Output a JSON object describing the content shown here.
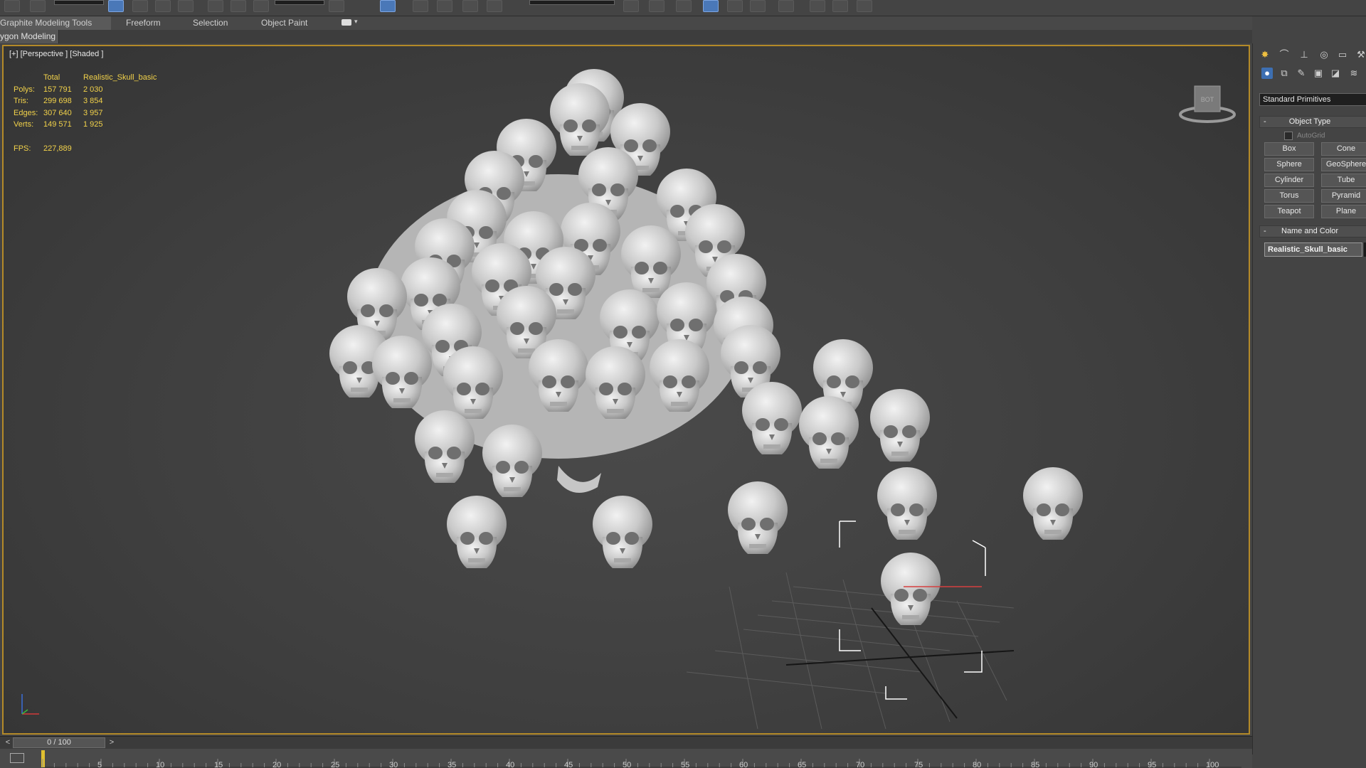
{
  "ribbon": {
    "tabs": [
      "Graphite Modeling Tools",
      "Freeform",
      "Selection",
      "Object Paint"
    ],
    "panel_label": "ygon Modeling"
  },
  "viewport": {
    "label": "[+] [Perspective ] [Shaded ]",
    "stats": {
      "header": [
        "Total",
        "Realistic_Skull_basic"
      ],
      "rows": [
        {
          "label": "Polys:",
          "total": "157 791",
          "selected": "2 030"
        },
        {
          "label": "Tris:",
          "total": "299 698",
          "selected": "3 854"
        },
        {
          "label": "Edges:",
          "total": "307 640",
          "selected": "3 957"
        },
        {
          "label": "Verts:",
          "total": "149 571",
          "selected": "1 925"
        }
      ],
      "fps_label": "FPS:",
      "fps_value": "227,889"
    },
    "viewcube_face": "BOT"
  },
  "command_panel": {
    "category_dropdown": "Standard Primitives",
    "object_type_title": "Object Type",
    "autogrid_label": "AutoGrid",
    "primitives": [
      [
        "Box",
        "Cone"
      ],
      [
        "Sphere",
        "GeoSphere"
      ],
      [
        "Cylinder",
        "Tube"
      ],
      [
        "Torus",
        "Pyramid"
      ],
      [
        "Teapot",
        "Plane"
      ]
    ],
    "name_color_title": "Name and Color",
    "object_name": "Realistic_Skull_basic"
  },
  "timeline": {
    "slider_label": "0 / 100",
    "prev": "<",
    "next": ">",
    "ticks": [
      "5",
      "10",
      "15",
      "20",
      "25",
      "30",
      "35",
      "40",
      "45",
      "50",
      "55",
      "60",
      "65",
      "70",
      "75",
      "80",
      "85",
      "90",
      "95",
      "100"
    ]
  },
  "colors": {
    "viewport_border": "#b48a28",
    "stats_text": "#f2d24a",
    "selection_accent": "#4a78b8"
  },
  "icons": [
    "undo-icon",
    "redo-icon",
    "select-icon",
    "select-by-name-icon",
    "rect-region-icon",
    "window-crossing-icon",
    "move-icon",
    "rotate-icon",
    "scale-icon",
    "snap-icon",
    "angle-snap-icon",
    "mirror-icon",
    "align-icon",
    "layer-icon",
    "curve-editor-icon",
    "schematic-icon",
    "material-editor-icon",
    "render-setup-icon",
    "render-icon"
  ]
}
